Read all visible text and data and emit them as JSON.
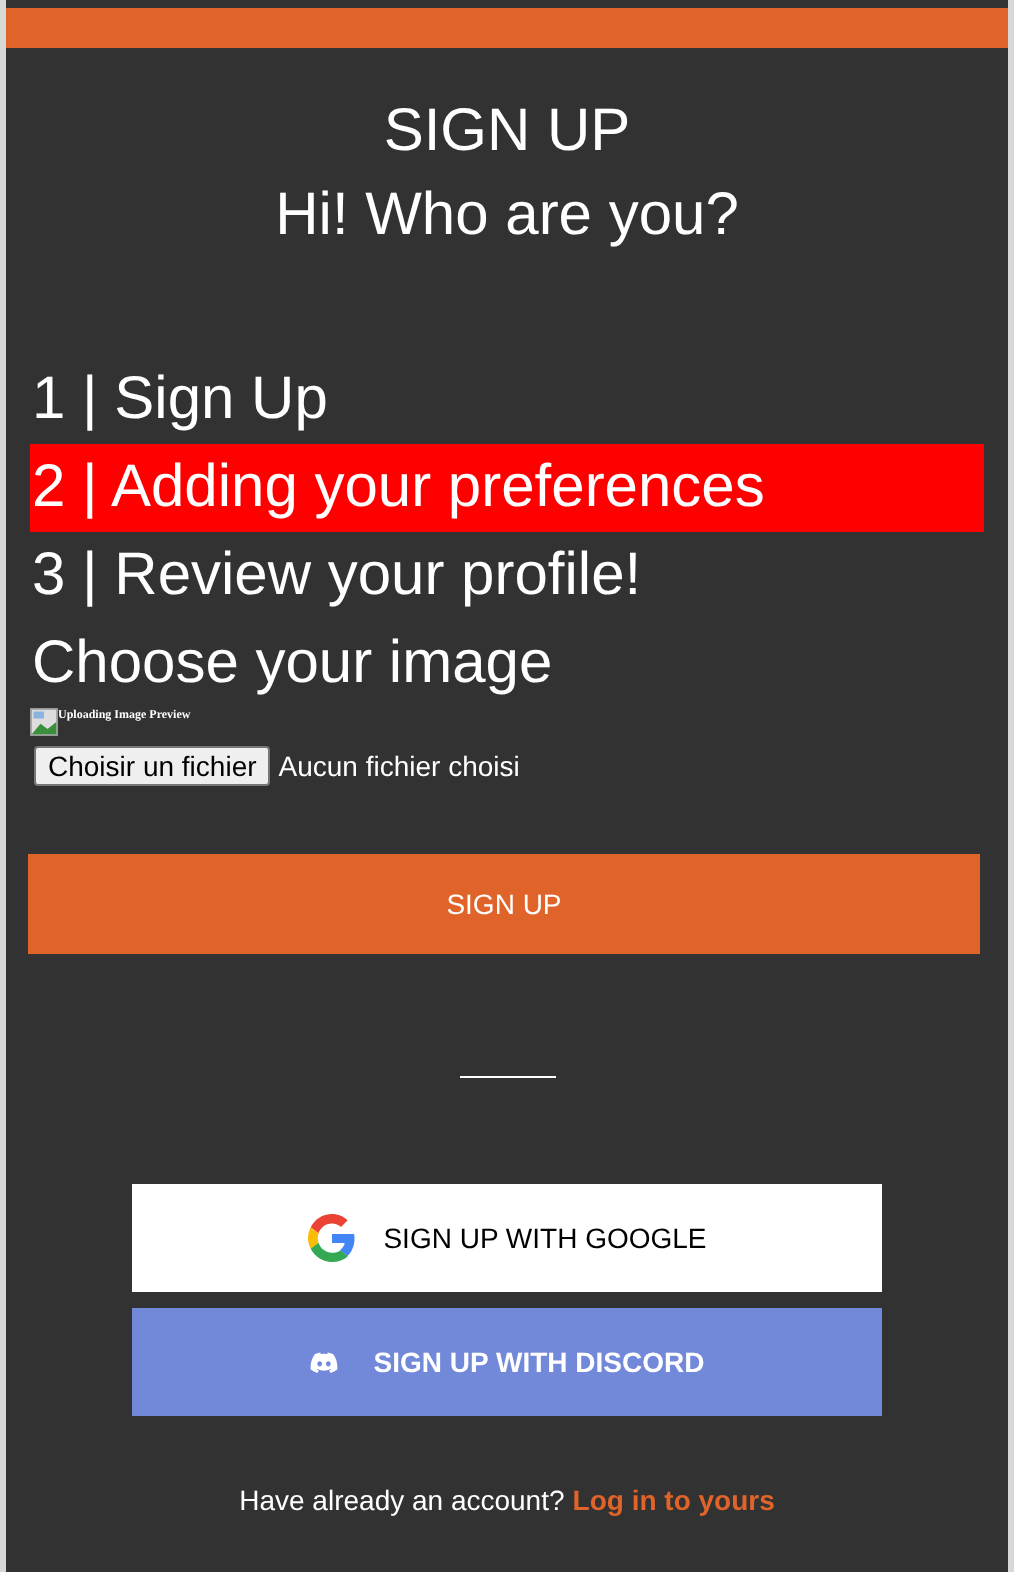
{
  "header": {
    "title": "SIGN UP",
    "subtitle": "Hi! Who are you?"
  },
  "steps": [
    {
      "label": "1 | Sign Up",
      "selected": false
    },
    {
      "label": "2 | Adding your preferences",
      "selected": true
    },
    {
      "label": "3 | Review your profile!",
      "selected": false
    }
  ],
  "image_section": {
    "heading": "Choose your image",
    "preview_alt": "Uploading Image Preview",
    "file_button": "Choisir un fichier",
    "file_status": "Aucun fichier choisi"
  },
  "submit_button": "SIGN UP",
  "social_buttons": [
    {
      "kind": "google",
      "label": "SIGN UP WITH GOOGLE"
    },
    {
      "kind": "discord",
      "label": "SIGN UP WITH DISCORD"
    }
  ],
  "footer": {
    "text": "Have already an account?",
    "link": "Log in to yours"
  }
}
